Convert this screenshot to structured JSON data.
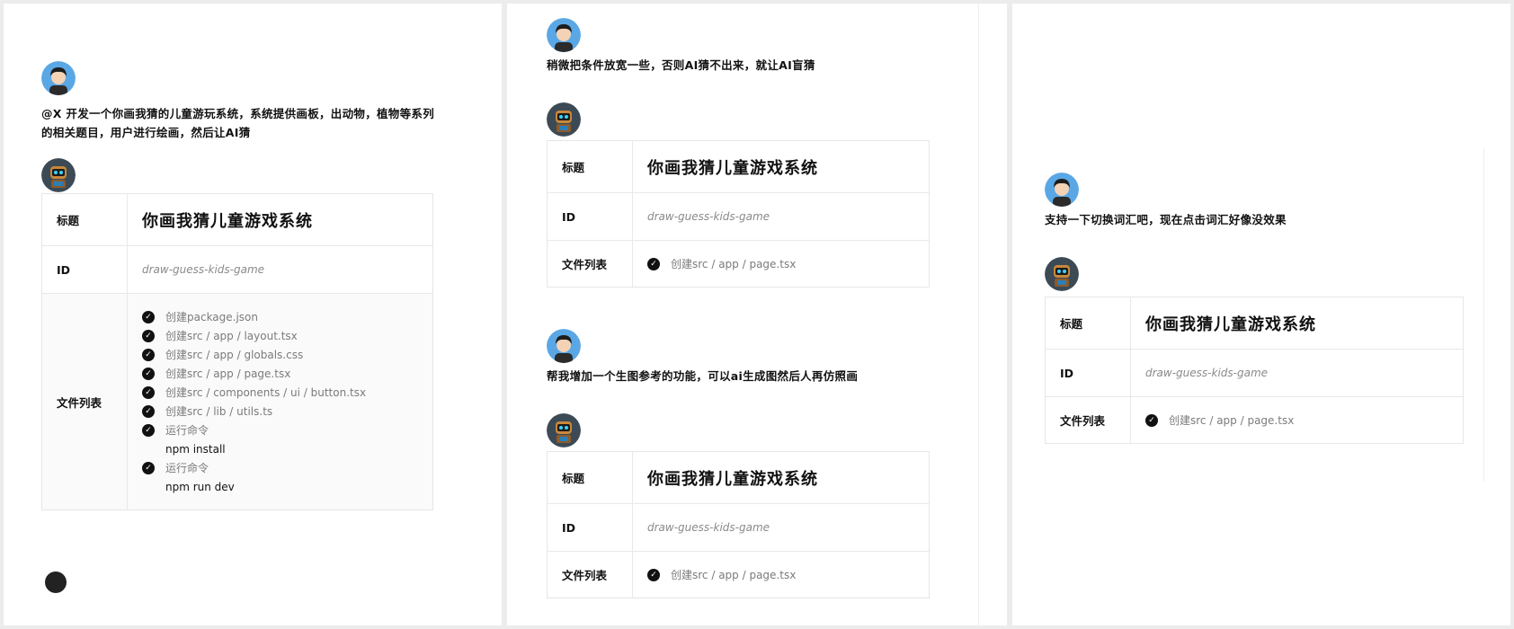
{
  "panel1": {
    "user_message": "@X 开发一个你画我猜的儿童游玩系统，系统提供画板，出动物，植物等系列的相关题目，用户进行绘画，然后让AI猜",
    "card": {
      "title_label": "标题",
      "title": "你画我猜儿童游戏系统",
      "id_label": "ID",
      "id": "draw-guess-kids-game",
      "files_label": "文件列表",
      "files": [
        {
          "text": "创建package.json"
        },
        {
          "text": "创建src / app / layout.tsx"
        },
        {
          "text": "创建src / app / globals.css"
        },
        {
          "text": "创建src / app / page.tsx"
        },
        {
          "text": "创建src / components / ui / button.tsx"
        },
        {
          "text": "创建src / lib / utils.ts"
        },
        {
          "text": "运行命令"
        },
        {
          "cmd": "npm install"
        },
        {
          "text": "运行命令"
        },
        {
          "cmd": "npm run dev"
        }
      ]
    }
  },
  "panel2": {
    "user_message_1": "稍微把条件放宽一些，否则AI猜不出来，就让AI盲猜",
    "card1": {
      "title_label": "标题",
      "title": "你画我猜儿童游戏系统",
      "id_label": "ID",
      "id": "draw-guess-kids-game",
      "files_label": "文件列表",
      "file": "创建src / app / page.tsx"
    },
    "user_message_2": "帮我增加一个生图参考的功能，可以ai生成图然后人再仿照画",
    "card2": {
      "title_label": "标题",
      "title": "你画我猜儿童游戏系统",
      "id_label": "ID",
      "id": "draw-guess-kids-game",
      "files_label": "文件列表",
      "file": "创建src / app / page.tsx"
    }
  },
  "panel3": {
    "user_message": "支持一下切换词汇吧，现在点击词汇好像没效果",
    "card": {
      "title_label": "标题",
      "title": "你画我猜儿童游戏系统",
      "id_label": "ID",
      "id": "draw-guess-kids-game",
      "files_label": "文件列表",
      "file": "创建src / app / page.tsx"
    }
  },
  "icons": {
    "user_avatar": "user-avatar-icon",
    "bot_avatar": "robot-avatar-icon",
    "check": "check-circle-icon"
  }
}
